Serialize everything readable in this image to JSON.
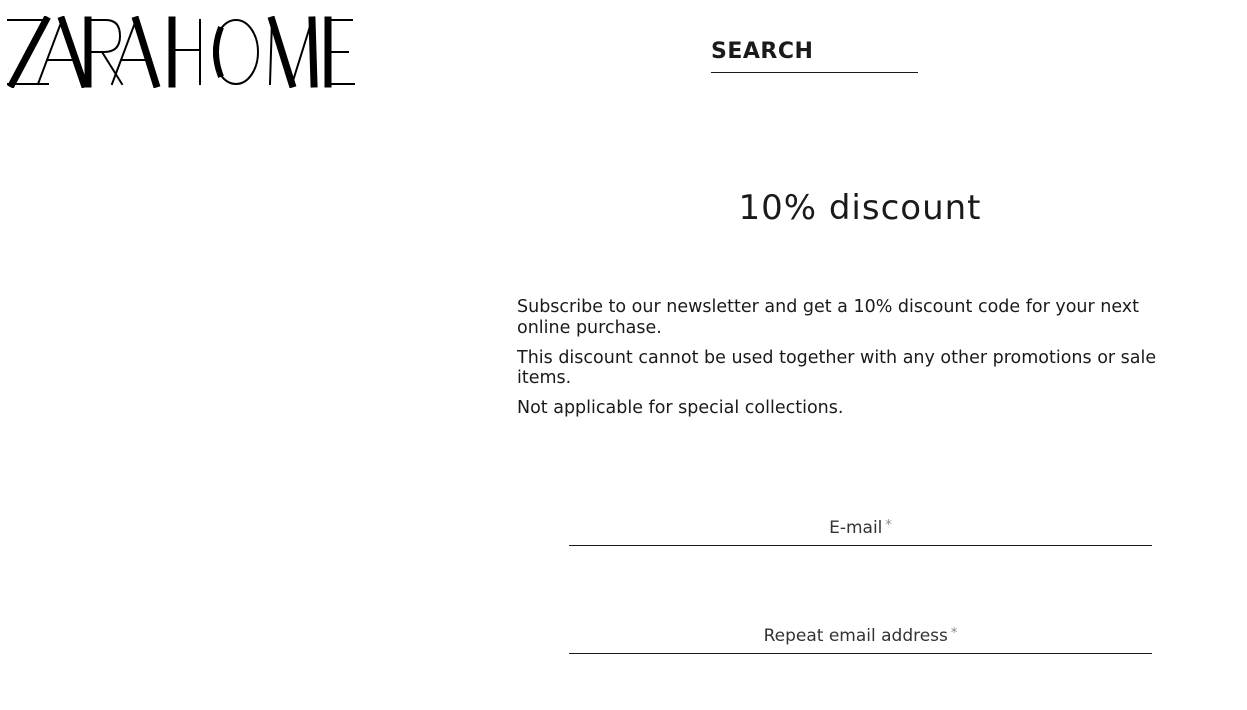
{
  "header": {
    "logo_text": "ZARAHOME",
    "search_label": "SEARCH"
  },
  "promo": {
    "title": "10% discount",
    "paragraphs": [
      "Subscribe to our newsletter and get a 10% discount code for your next online purchase.",
      "This discount cannot be used together with any other promotions or sale items.",
      "Not applicable for special collections."
    ]
  },
  "form": {
    "email_label": "E-mail",
    "repeat_email_label": "Repeat email address",
    "required_mark": "*"
  }
}
